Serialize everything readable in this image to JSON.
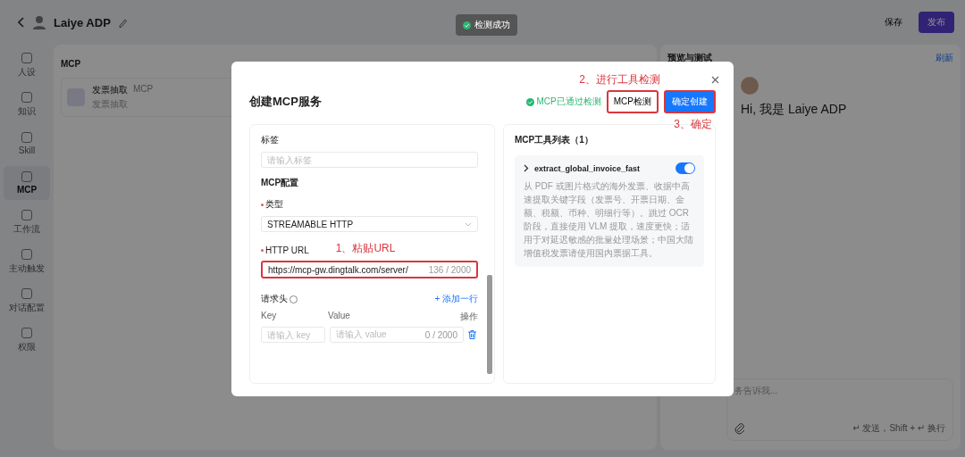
{
  "header": {
    "title": "Laiye ADP",
    "save": "保存",
    "publish": "发布"
  },
  "toast": "检测成功",
  "sidebar": {
    "items": [
      {
        "label": "人设",
        "selected": false
      },
      {
        "label": "知识",
        "selected": false
      },
      {
        "label": "Skill",
        "selected": false
      },
      {
        "label": "MCP",
        "selected": true
      },
      {
        "label": "工作流",
        "selected": false
      },
      {
        "label": "主动触发",
        "selected": false
      },
      {
        "label": "对话配置",
        "selected": false
      },
      {
        "label": "权限",
        "selected": false
      }
    ]
  },
  "mcp_section": {
    "title": "MCP",
    "card": {
      "name": "发票抽取",
      "tag": "MCP",
      "description": "发票抽取"
    }
  },
  "preview": {
    "title": "预览与测试",
    "refresh": "刷新",
    "greeting": "Hi, 我是 Laiye ADP",
    "input_placeholder": "务告诉我...",
    "hint": "↵ 发送，Shift + ↵ 换行"
  },
  "dialog": {
    "title": "创建MCP服务",
    "status": "MCP已通过检测",
    "check_button": "MCP检测",
    "confirm_button": "确定创建",
    "annotations": [
      "1、粘贴URL",
      "2、进行工具检测",
      "3、确定"
    ],
    "form": {
      "tag_label": "标签",
      "tag_placeholder": "请输入标签",
      "config_title": "MCP配置",
      "type": {
        "label": "类型",
        "required": true,
        "value": "STREAMABLE HTTP"
      },
      "url": {
        "label": "HTTP URL",
        "required": true,
        "value": "https://mcp-gw.dingtalk.com/server/",
        "count": "136 / 2000"
      },
      "headers": {
        "label": "请求头",
        "add": "+ 添加一行",
        "columns": [
          "Key",
          "Value",
          "操作"
        ],
        "key_placeholder": "请输入 key",
        "value_placeholder": "请输入 value",
        "count": "0 / 2000"
      }
    },
    "tools": {
      "title": "MCP工具列表（1）",
      "items": [
        {
          "name": "extract_global_invoice_fast",
          "enabled": true,
          "description": "从 PDF 或图片格式的海外发票、收据中高速提取关键字段（发票号、开票日期、金额、税额、币种、明细行等）。跳过 OCR 阶段，直接使用 VLM 提取，速度更快；适用于对延迟敏感的批量处理场景；中国大陆增值税发票请使用国内票据工具。"
        }
      ]
    }
  }
}
